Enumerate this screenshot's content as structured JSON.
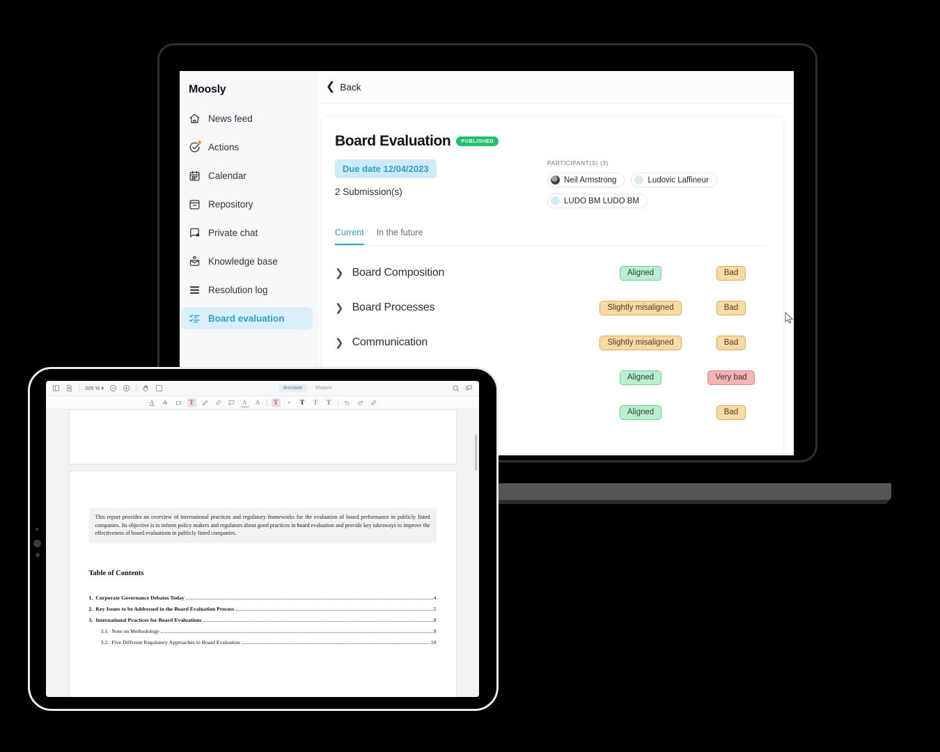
{
  "app": {
    "brand": "Moosly",
    "back_label": "Back",
    "sidebar": {
      "items": [
        {
          "label": "News feed",
          "icon": "home-icon",
          "active": false
        },
        {
          "label": "Actions",
          "icon": "check-circle-icon",
          "active": false,
          "badge": true
        },
        {
          "label": "Calendar",
          "icon": "calendar-icon",
          "active": false
        },
        {
          "label": "Repository",
          "icon": "archive-icon",
          "active": false
        },
        {
          "label": "Private chat",
          "icon": "chat-lock-icon",
          "active": false
        },
        {
          "label": "Knowledge base",
          "icon": "knowledge-base-icon",
          "active": false
        },
        {
          "label": "Resolution log",
          "icon": "list-icon",
          "active": false
        },
        {
          "label": "Board evaluation",
          "icon": "checklist-icon",
          "active": true
        }
      ]
    },
    "evaluation": {
      "title": "Board Evaluation",
      "status_badge": "PUBLISHED",
      "due_date": "Due date 12/04/2023",
      "submissions": "2 Submission(s)",
      "participants_label": "PARTICIPANT(S) (3)",
      "participants": [
        {
          "name": "Neil Armstrong",
          "avatar": "photo"
        },
        {
          "name": "Ludovic Laffineur",
          "avatar": "blank"
        },
        {
          "name": "LUDO BM LUDO BM",
          "avatar": "blank"
        }
      ],
      "tabs": [
        {
          "label": "Current",
          "active": true
        },
        {
          "label": "In the future",
          "active": false
        }
      ],
      "rows": [
        {
          "name": "Board Composition",
          "statusA": "Aligned",
          "colorA": "green",
          "statusB": "Bad",
          "colorB": "orange"
        },
        {
          "name": "Board Processes",
          "statusA": "Slightly misaligned",
          "colorA": "orange",
          "statusB": "Bad",
          "colorB": "orange"
        },
        {
          "name": "Communication",
          "statusA": "Slightly misaligned",
          "colorA": "orange",
          "statusB": "Bad",
          "colorB": "orange"
        },
        {
          "name": "",
          "statusA": "Aligned",
          "colorA": "green",
          "statusB": "Very bad",
          "colorB": "red"
        },
        {
          "name": "",
          "statusA": "Aligned",
          "colorA": "green",
          "statusB": "Bad",
          "colorB": "orange"
        }
      ]
    },
    "colors": {
      "accent": "#2f9fd4",
      "published_green": "#23c16b",
      "badge_green": "#b9f0cd",
      "badge_orange": "#f9dba6",
      "badge_red": "#f4b4b4",
      "sidebar_active_bg": "#d9effa",
      "due_date_bg": "#cfeaf7"
    }
  },
  "tablet": {
    "pdf": {
      "zoom_level": "205 %",
      "mode_tabs": [
        {
          "label": "Annotate",
          "active": true
        },
        {
          "label": "Shapes",
          "active": false
        }
      ],
      "text_tools": [
        "T",
        "T",
        "T",
        "T"
      ],
      "document": {
        "abstract": "This report provides an overview of international practices and regulatory frameworks for the evaluation of board performance in publicly listed companies. Its objective is to inform policy makers and regulators about good practices in board evaluation and provide key takeaways to improve the effectiveness of board evaluations in publicly listed companies.",
        "toc_heading": "Table of Contents",
        "toc": [
          {
            "num": "1.",
            "title": "Corporate Governance Debates Today",
            "page": "4",
            "sub": false
          },
          {
            "num": "2.",
            "title": "Key Issues to be Addressed in the Board Evaluation Process",
            "page": "5",
            "sub": false
          },
          {
            "num": "3.",
            "title": "International Practices for Board Evaluations",
            "page": "8",
            "sub": false
          },
          {
            "num": "3.1.",
            "title": "Note on Methodology",
            "page": "9",
            "sub": true
          },
          {
            "num": "3.2.",
            "title": "Five Different Regulatory Approaches to Board Evaluation",
            "page": "10",
            "sub": true
          }
        ]
      }
    }
  }
}
